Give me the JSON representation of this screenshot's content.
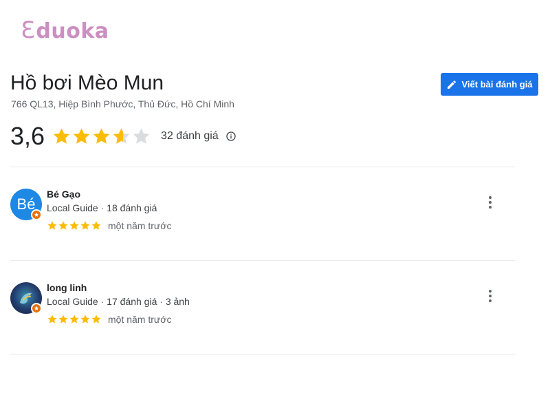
{
  "logo": {
    "prefix": "Ɛ",
    "text": "duoka"
  },
  "place": {
    "title": "Hồ bơi Mèo Mun",
    "address": "766 QL13, Hiệp Bình Phước, Thủ Đức, Hồ Chí Minh"
  },
  "write_review": {
    "label": "Viết bài đánh giá",
    "icon": "pencil-icon"
  },
  "rating": {
    "score": "3,6",
    "stars_value": 3.6,
    "stars_max": 5,
    "count_label": "32 đánh giá",
    "info_icon": "info-icon"
  },
  "colors": {
    "accent": "#1a73e8",
    "star": "#fbbc04",
    "star_empty": "#dadce0",
    "logo": "#cc8fc1",
    "guide_badge": "#e8710a"
  },
  "reviews": [
    {
      "avatar_text": "Bé",
      "name": "Bé Gạo",
      "role": "Local Guide",
      "sep1": " · ",
      "stats": "18 đánh giá",
      "stars": 5,
      "time": "một năm trước",
      "more_icon": "more-vert-icon"
    },
    {
      "avatar_text": "",
      "name": "long linh",
      "role": "Local Guide",
      "sep1": " · ",
      "stats": "17 đánh giá",
      "sep2": " · ",
      "photos": "3 ảnh",
      "stars": 5,
      "time": "một năm trước",
      "more_icon": "more-vert-icon"
    }
  ]
}
